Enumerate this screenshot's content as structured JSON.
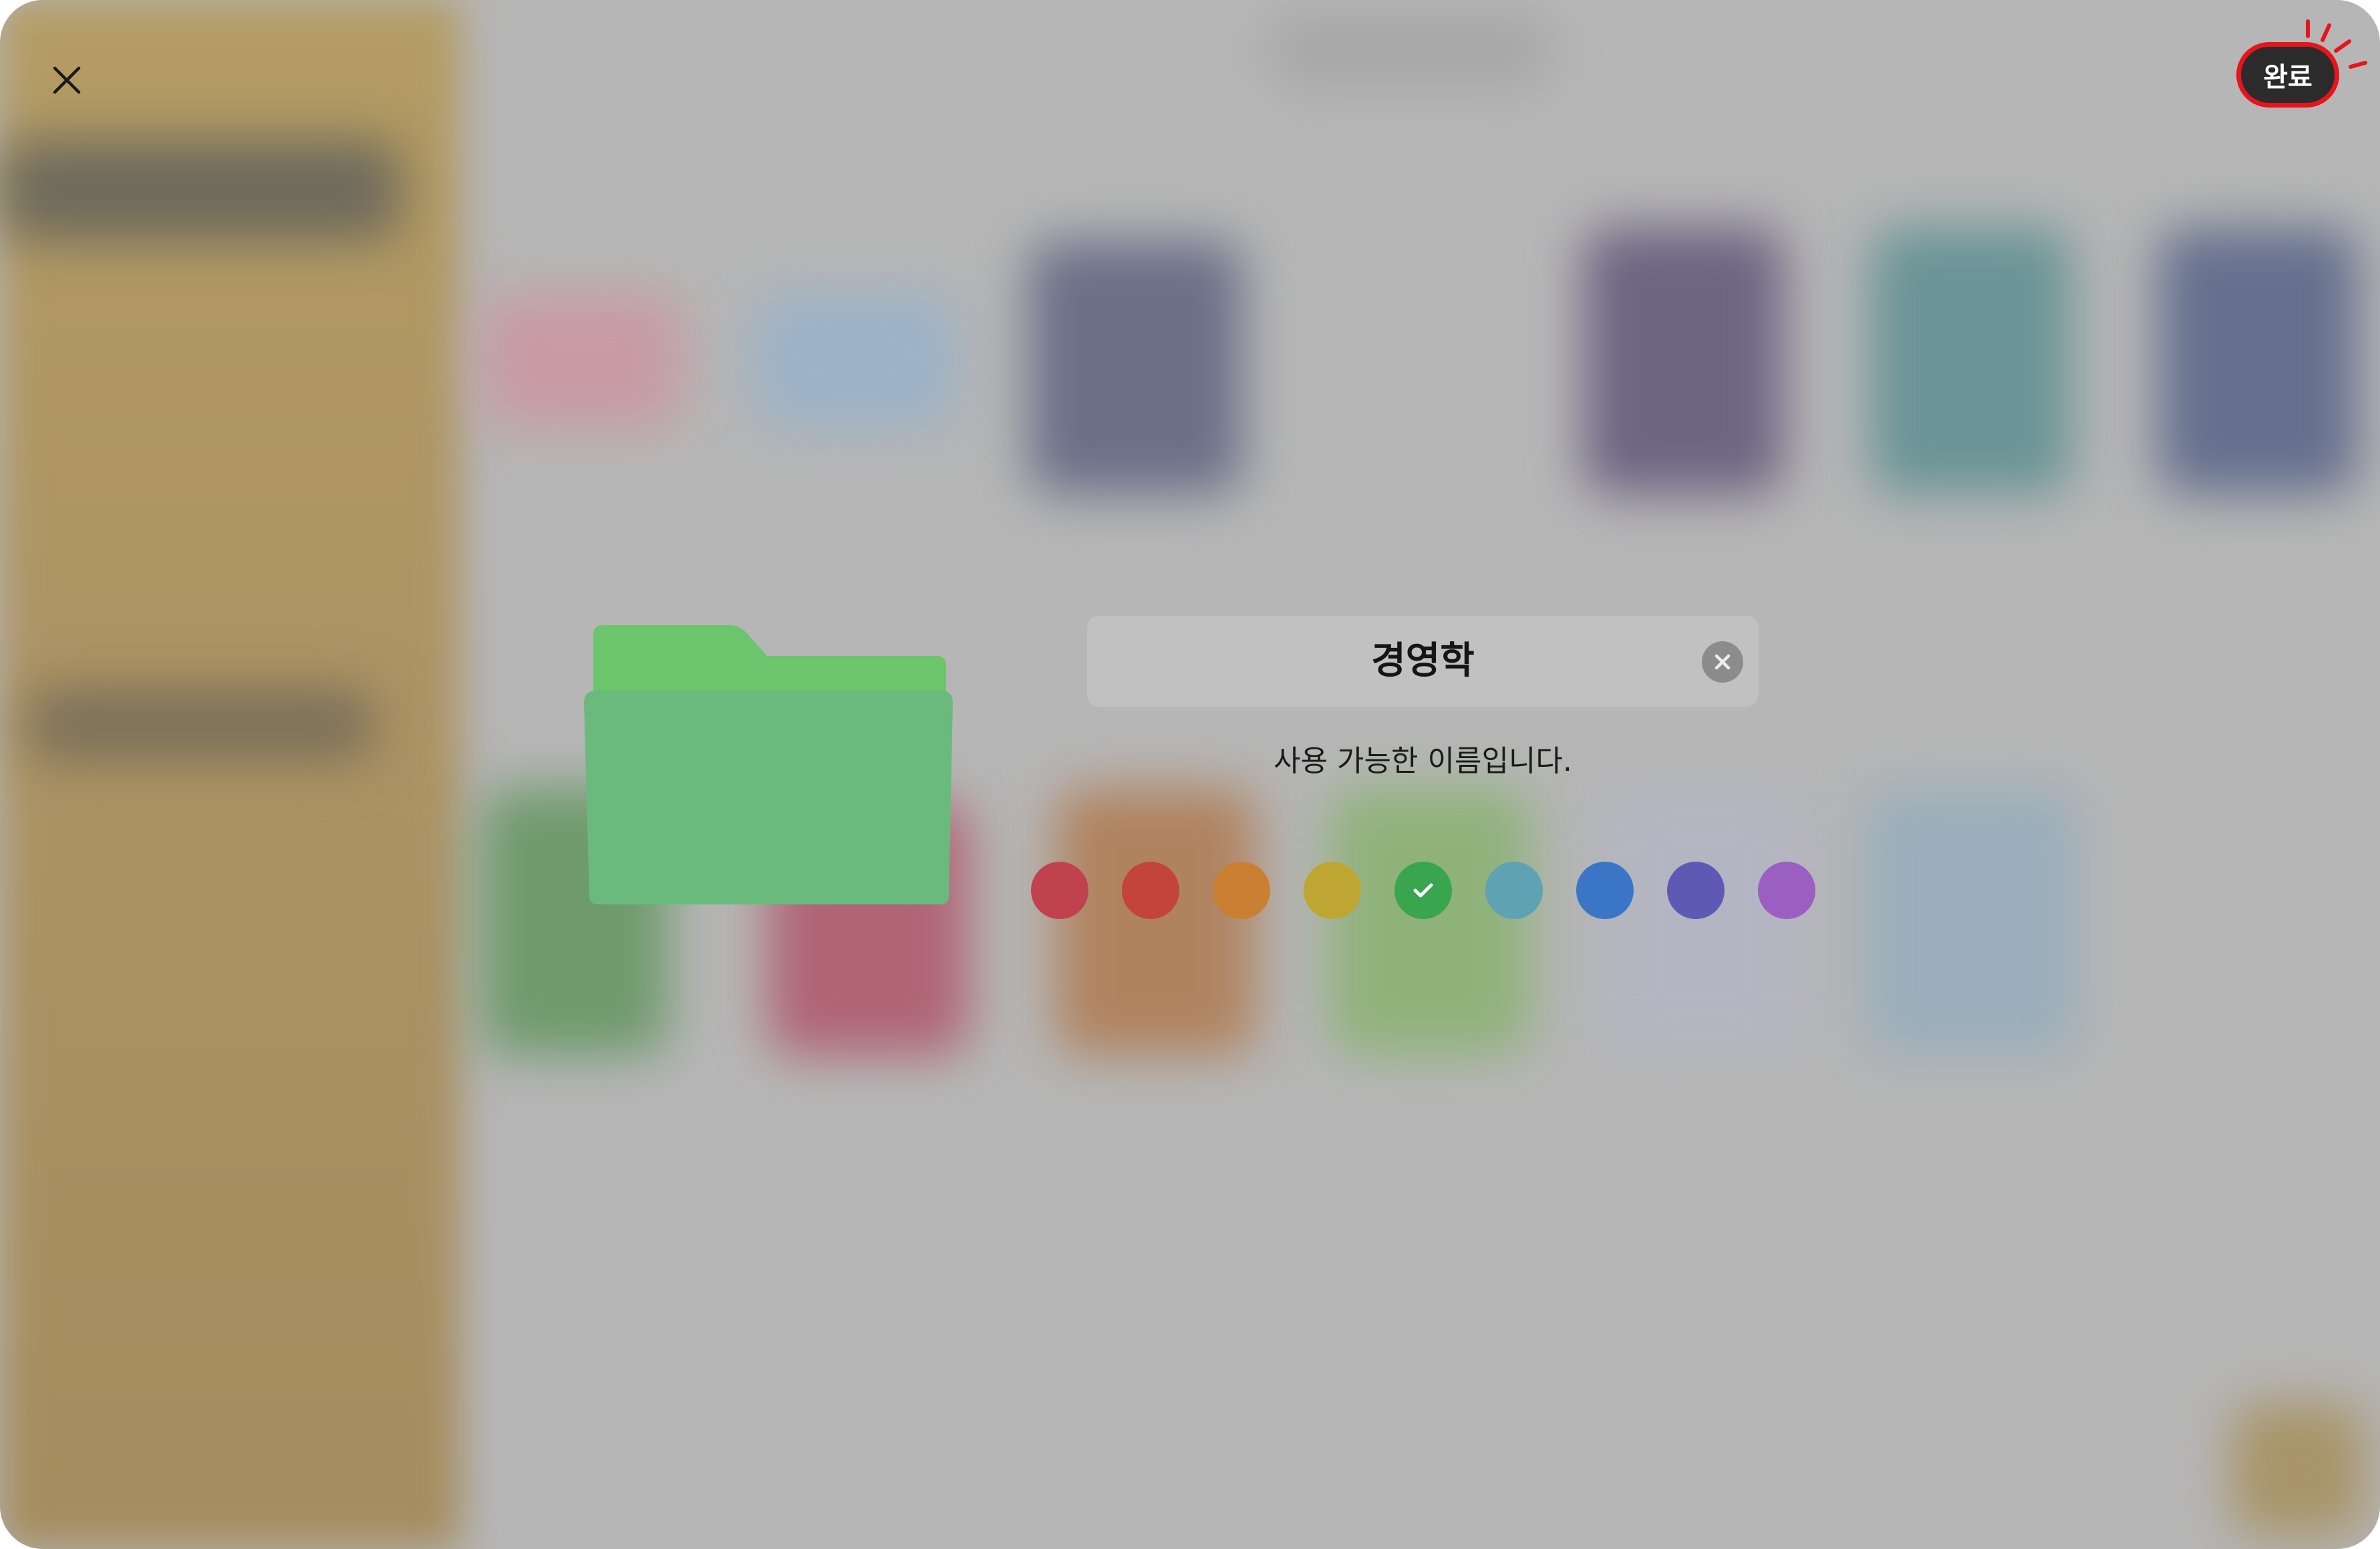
{
  "header": {
    "close_icon": "close-icon",
    "done_label": "완료"
  },
  "folder": {
    "icon": "folder-icon",
    "color": "#6cbf7e",
    "name_value": "경영학",
    "clear_icon": "clear-circle-icon",
    "status_text": "사용 가능한 이름입니다."
  },
  "colors": {
    "selected": "green",
    "options": [
      {
        "name": "rose",
        "hex": "#c0424f"
      },
      {
        "name": "red",
        "hex": "#c2443a"
      },
      {
        "name": "orange",
        "hex": "#c98033"
      },
      {
        "name": "yellow",
        "hex": "#bfa632"
      },
      {
        "name": "green",
        "hex": "#3aa54f"
      },
      {
        "name": "teal",
        "hex": "#5fa2b3"
      },
      {
        "name": "blue",
        "hex": "#3a76c5"
      },
      {
        "name": "indigo",
        "hex": "#5e5ab3"
      },
      {
        "name": "purple",
        "hex": "#9a5fc0"
      }
    ]
  },
  "highlight": {
    "accent": "#e8141b"
  }
}
